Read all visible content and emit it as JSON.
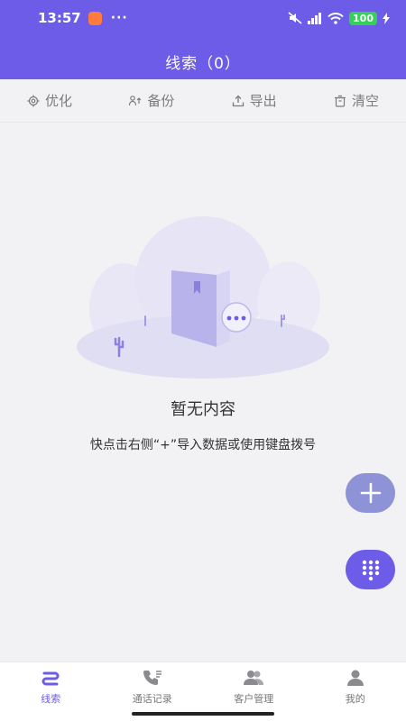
{
  "status_bar": {
    "time": "13:57",
    "notification_icon": "app-notification-icon",
    "more": "···",
    "battery": "100"
  },
  "header": {
    "title": "线索（0）"
  },
  "toolbar": {
    "optimize": "优化",
    "backup": "备份",
    "export": "导出",
    "clear": "清空"
  },
  "empty_state": {
    "title": "暂无内容",
    "hint": "快点击右侧“+”导入数据或使用键盘拨号"
  },
  "fab": {
    "add_icon": "plus-icon",
    "dial_icon": "dialpad-icon"
  },
  "bottom_nav": {
    "items": [
      {
        "label": "线索",
        "icon": "leads-icon"
      },
      {
        "label": "通话记录",
        "icon": "phone-call-log-icon"
      },
      {
        "label": "客户管理",
        "icon": "customers-icon"
      },
      {
        "label": "我的",
        "icon": "profile-icon"
      }
    ]
  },
  "colors": {
    "primary": "#6c5ce7",
    "fab_add": "#8e92d6",
    "background": "#f2f2f4"
  }
}
